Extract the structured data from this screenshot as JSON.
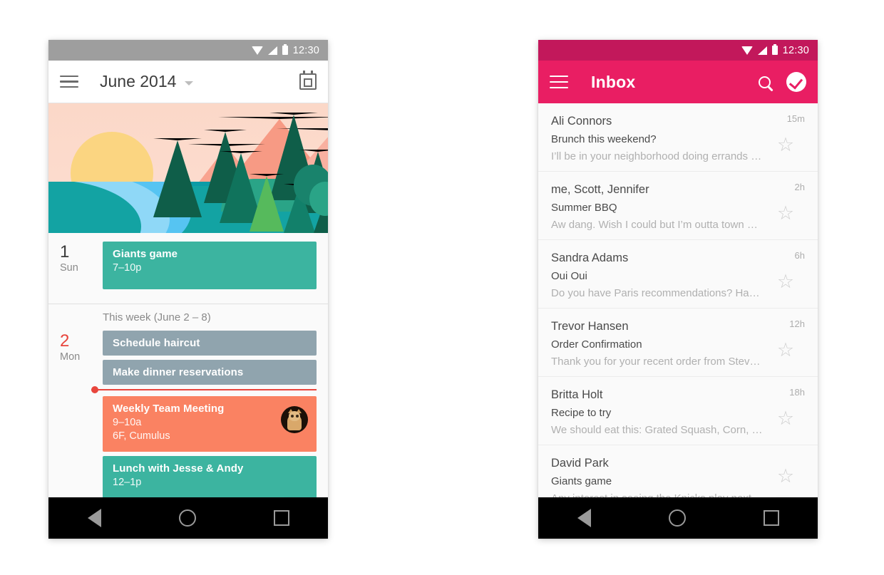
{
  "page": {
    "background": "#ffffff"
  },
  "calendar_phone": {
    "status_bar": {
      "time": "12:30",
      "background": "#9e9e9e",
      "icons": [
        "wifi-icon",
        "signal-icon",
        "battery-icon"
      ]
    },
    "app_bar": {
      "background": "#ffffff",
      "menu_icon": "hamburger-icon",
      "title": "June 2014",
      "dropdown_icon": "chevron-down-icon",
      "action_icon": "calendar-today-icon"
    },
    "hero_image": {
      "name": "landscape-illustration",
      "colors": {
        "sky": "#fbd9cb",
        "sun": "#fbd581",
        "water": "#0c9ba6",
        "trees": "#0f5e49",
        "mountains": "#f79a84"
      }
    },
    "days": [
      {
        "date": "1",
        "dow": "Sun",
        "is_today": false,
        "events": [
          {
            "title": "Giants game",
            "sub": "7–10p",
            "color": "#3cb4a0",
            "has_avatar": false
          }
        ]
      },
      {
        "week_label": "This week (June 2 – 8)",
        "date": "2",
        "dow": "Mon",
        "is_today": true,
        "events": [
          {
            "title": "Schedule haircut",
            "sub": "",
            "color": "#90a4ae",
            "has_avatar": false
          },
          {
            "title": "Make dinner reservations",
            "sub": "",
            "color": "#90a4ae",
            "has_avatar": false
          },
          {
            "title": "Weekly Team Meeting",
            "sub": "9–10a",
            "sub2": "6F, Cumulus",
            "color": "#fa8262",
            "has_avatar": true
          },
          {
            "title": "Lunch with Jesse & Andy",
            "sub": "12–1p",
            "color": "#3cb4a0",
            "has_avatar": false
          }
        ]
      }
    ],
    "now_indicator": {
      "color": "#e8453c"
    },
    "fab": {
      "name": "add-event-fab",
      "icon": "plus-icon",
      "color": "#f4513d"
    },
    "nav_bar": {
      "back": "back-icon",
      "home": "home-icon",
      "recents": "recents-icon"
    }
  },
  "inbox_phone": {
    "status_bar": {
      "time": "12:30",
      "background": "#c2185b",
      "icons": [
        "wifi-icon",
        "signal-icon",
        "battery-icon"
      ]
    },
    "app_bar": {
      "background": "#e91e63",
      "menu_icon": "hamburger-icon",
      "title": "Inbox",
      "search_icon": "search-icon",
      "done_icon": "check-circle-icon"
    },
    "emails": [
      {
        "sender": "Ali Connors",
        "subject": "Brunch this weekend?",
        "preview": "I’ll be in your neighborhood doing errands …",
        "time": "15m",
        "starred": false
      },
      {
        "sender": "me, Scott, Jennifer",
        "subject": "Summer BBQ",
        "preview": "Aw dang. Wish I could but I’m outta town …",
        "time": "2h",
        "starred": false
      },
      {
        "sender": "Sandra Adams",
        "subject": "Oui Oui",
        "preview": "Do you have Paris recommendations? Hav…",
        "time": "6h",
        "starred": false
      },
      {
        "sender": "Trevor Hansen",
        "subject": "Order Confirmation",
        "preview": "Thank you for your recent order from Stev…",
        "time": "12h",
        "starred": false
      },
      {
        "sender": "Britta Holt",
        "subject": "Recipe to try",
        "preview": "We should eat this: Grated Squash, Corn, …",
        "time": "18h",
        "starred": false
      },
      {
        "sender": "David Park",
        "subject": "Giants game",
        "preview": "Any interest in seeing the Knicks play next …",
        "time": "",
        "starred": false
      }
    ],
    "star_glyph": "☆",
    "fab": {
      "name": "compose-fab",
      "icon": "plus-icon",
      "color": "#21e6ef"
    },
    "nav_bar": {
      "back": "back-icon",
      "home": "home-icon",
      "recents": "recents-icon"
    }
  }
}
